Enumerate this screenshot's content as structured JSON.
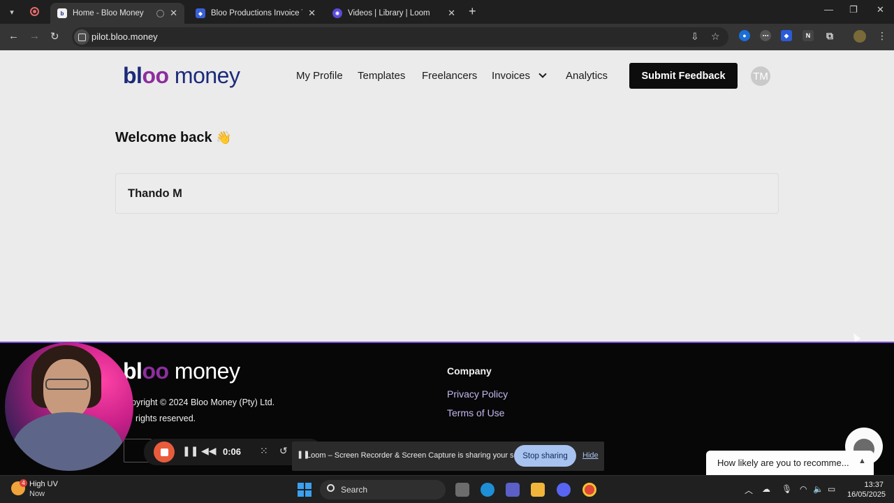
{
  "browser": {
    "tabs": [
      {
        "title": "Home - Bloo Money",
        "active": true
      },
      {
        "title": "Bloo Productions Invoice Templ",
        "active": false
      },
      {
        "title": "Videos | Library | Loom",
        "active": false
      }
    ],
    "url": "pilot.bloo.money"
  },
  "header": {
    "logo": {
      "b": "bl",
      "oo": "oo",
      "m": " money"
    },
    "nav": [
      "My Profile",
      "Templates",
      "Freelancers",
      "Invoices",
      "Analytics"
    ],
    "feedback_label": "Submit Feedback",
    "avatar_initials": "TM"
  },
  "main": {
    "welcome": "Welcome back",
    "wave": "👋",
    "card_name": "Thando M"
  },
  "footer": {
    "copyright": "pyright © 2024 Bloo Money (Pty) Ltd.",
    "rights": "rights reserved.",
    "company_heading": "Company",
    "links": [
      "Privacy Policy",
      "Terms of Use"
    ]
  },
  "loom": {
    "timer": "0:06",
    "share_text": "Loom – Screen Recorder & Screen Capture is sharing your screen.",
    "stop_sharing": "Stop sharing",
    "hide": "Hide"
  },
  "survey": {
    "text": "How likely are you to recomme..."
  },
  "taskbar": {
    "weather_badge": "4",
    "weather_line1": "High UV",
    "weather_line2": "Now",
    "search_label": "Search",
    "time": "13:37",
    "date": "16/05/2025"
  },
  "colors": {
    "brand_navy": "#1c2a7a",
    "brand_purple": "#8d2e9e",
    "loom_red": "#e85c3c",
    "link_lavender": "#c5b7f0"
  }
}
